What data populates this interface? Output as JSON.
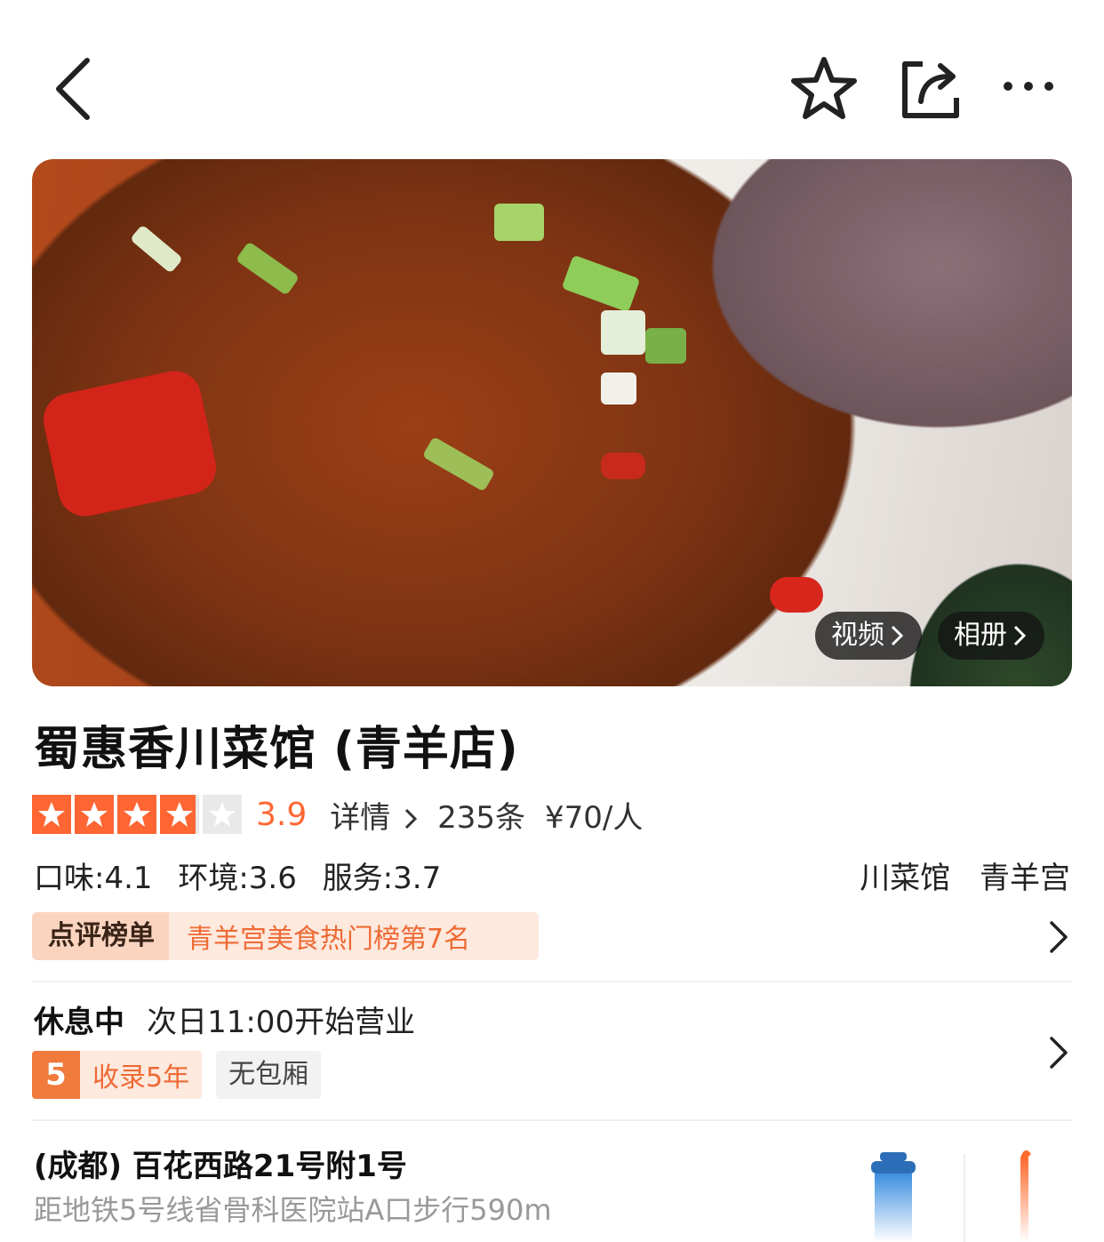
{
  "header": {
    "back_icon": "back-arrow-icon",
    "favorite_icon": "star-outline-icon",
    "share_icon": "share-icon",
    "more_icon": "more-dots-icon"
  },
  "hero": {
    "video_label": "视频",
    "album_label": "相册"
  },
  "shop": {
    "name": "蜀惠香川菜馆 (青羊店)",
    "rating_value": "3.9",
    "rating_fraction": 0.78,
    "details_label": "详情",
    "review_count": "235条",
    "price": "¥70/人",
    "scores": [
      "口味:4.1",
      "环境:3.6",
      "服务:3.7"
    ],
    "tags": [
      "川菜馆",
      "青羊宫"
    ]
  },
  "ranking": {
    "label": "点评榜单",
    "text": "青羊宫美食热门榜第7名"
  },
  "hours": {
    "status": "休息中",
    "text": "次日11:00开始营业"
  },
  "badges": {
    "years_number": "5",
    "years_text": "收录5年",
    "room_text": "无包厢"
  },
  "address": {
    "line": "(成都) 百花西路21号附1号",
    "metro": "距地铁5号线省骨科医院站A口步行590m"
  },
  "colors": {
    "accent": "#ff6633",
    "rank_bg": "#fde9de",
    "rank_label_bg": "#fbd4bf",
    "star_empty": "#e9e9e9"
  }
}
